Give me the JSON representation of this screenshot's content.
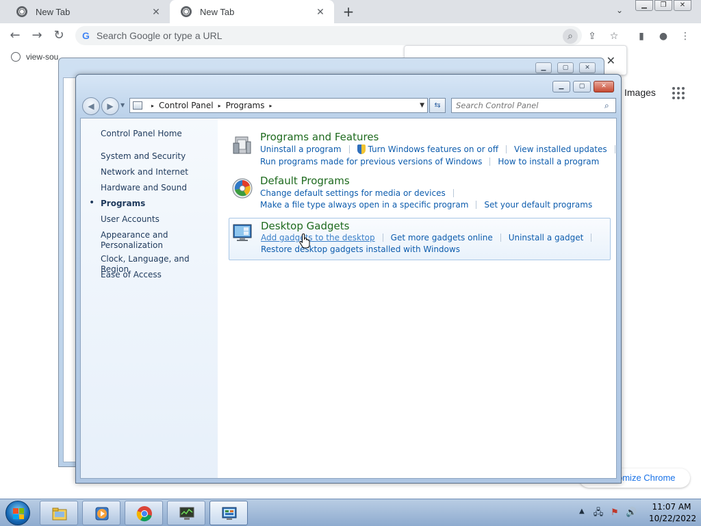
{
  "chrome": {
    "tabs": [
      {
        "title": "New Tab",
        "close": "✕"
      },
      {
        "title": "New Tab",
        "close": "✕"
      }
    ],
    "new_tab": "+",
    "tab_search": "⌄",
    "window_controls": {
      "minimize": "▁",
      "restore": "❐",
      "close": "✕"
    },
    "nav": {
      "back": "←",
      "forward": "→",
      "reload": "↻"
    },
    "omnibox": {
      "icon": "G",
      "placeholder": "Search Google or type a URL"
    },
    "toolbar_icons": {
      "lens": "⌕",
      "share": "⇪",
      "star": "☆",
      "sidepanel": "▮",
      "profile": "●",
      "menu": "⋮"
    },
    "bookmark": {
      "label": "view-sou"
    },
    "popup_close": "✕",
    "images_link": "Images",
    "customize_label": "omize Chrome"
  },
  "bg_window": {
    "controls": {
      "minimize": "▁",
      "maximize": "▢",
      "close": "✕"
    }
  },
  "control_panel": {
    "controls": {
      "minimize": "▁",
      "maximize": "▢",
      "close": "✕"
    },
    "nav": {
      "back": "◀",
      "forward": "▶",
      "history": "▼"
    },
    "breadcrumb": [
      "Control Panel",
      "Programs"
    ],
    "breadcrumb_sep": "▸",
    "address_drop": "▼",
    "refresh": "⇆",
    "search_placeholder": "Search Control Panel",
    "search_icon": "⌕",
    "sidebar": {
      "home": "Control Panel Home",
      "items": [
        {
          "label": "System and Security"
        },
        {
          "label": "Network and Internet"
        },
        {
          "label": "Hardware and Sound"
        },
        {
          "label": "Programs"
        },
        {
          "label": "User Accounts"
        },
        {
          "label": "Appearance and\nPersonalization"
        },
        {
          "label": "Clock, Language, and Region"
        },
        {
          "label": "Ease of Access"
        }
      ],
      "current_bullet": "•"
    },
    "categories": [
      {
        "title": "Programs and Features",
        "rows": [
          [
            "Uninstall a program",
            "Turn Windows features on or off",
            "View installed updates"
          ],
          [
            "Run programs made for previous versions of Windows",
            "How to install a program"
          ]
        ]
      },
      {
        "title": "Default Programs",
        "rows": [
          [
            "Change default settings for media or devices"
          ],
          [
            "Make a file type always open in a specific program",
            "Set your default programs"
          ]
        ]
      },
      {
        "title": "Desktop Gadgets",
        "rows": [
          [
            "Add gadgets to the desktop",
            "Get more gadgets online",
            "Uninstall a gadget"
          ],
          [
            "Restore desktop gadgets installed with Windows"
          ]
        ]
      }
    ]
  },
  "taskbar": {
    "tray_arrow": "▲",
    "tray_icons": {
      "network": "🖧",
      "flag": "⚑",
      "volume": "🔊"
    },
    "time": "11:07 AM",
    "date": "10/22/2022"
  },
  "colors": {
    "category_title": "#1e6a1e",
    "link": "#0d5cad",
    "sidebar_text": "#1e395b"
  }
}
